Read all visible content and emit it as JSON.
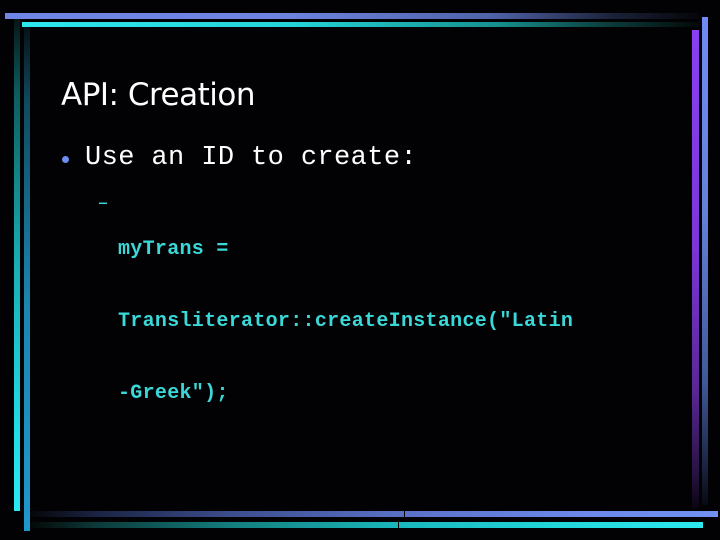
{
  "slide": {
    "title": "API: Creation",
    "bullets": [
      {
        "text": "Use an ID to create:",
        "bullet_color": "#6c8ef0",
        "sub_items": [
          {
            "dash": "–",
            "lines": [
              "myTrans =",
              "Transliterator::createInstance(\"Latin",
              "-Greek\");"
            ]
          }
        ]
      }
    ]
  },
  "theme": {
    "background": "#000000",
    "title_color": "#ffffff",
    "text_color": "#ffffff",
    "code_color": "#3ad8d8",
    "frame_colors": {
      "blue": "#6f86e6",
      "cyan": "#2ee6ee",
      "purple": "#8a3ff2"
    }
  }
}
